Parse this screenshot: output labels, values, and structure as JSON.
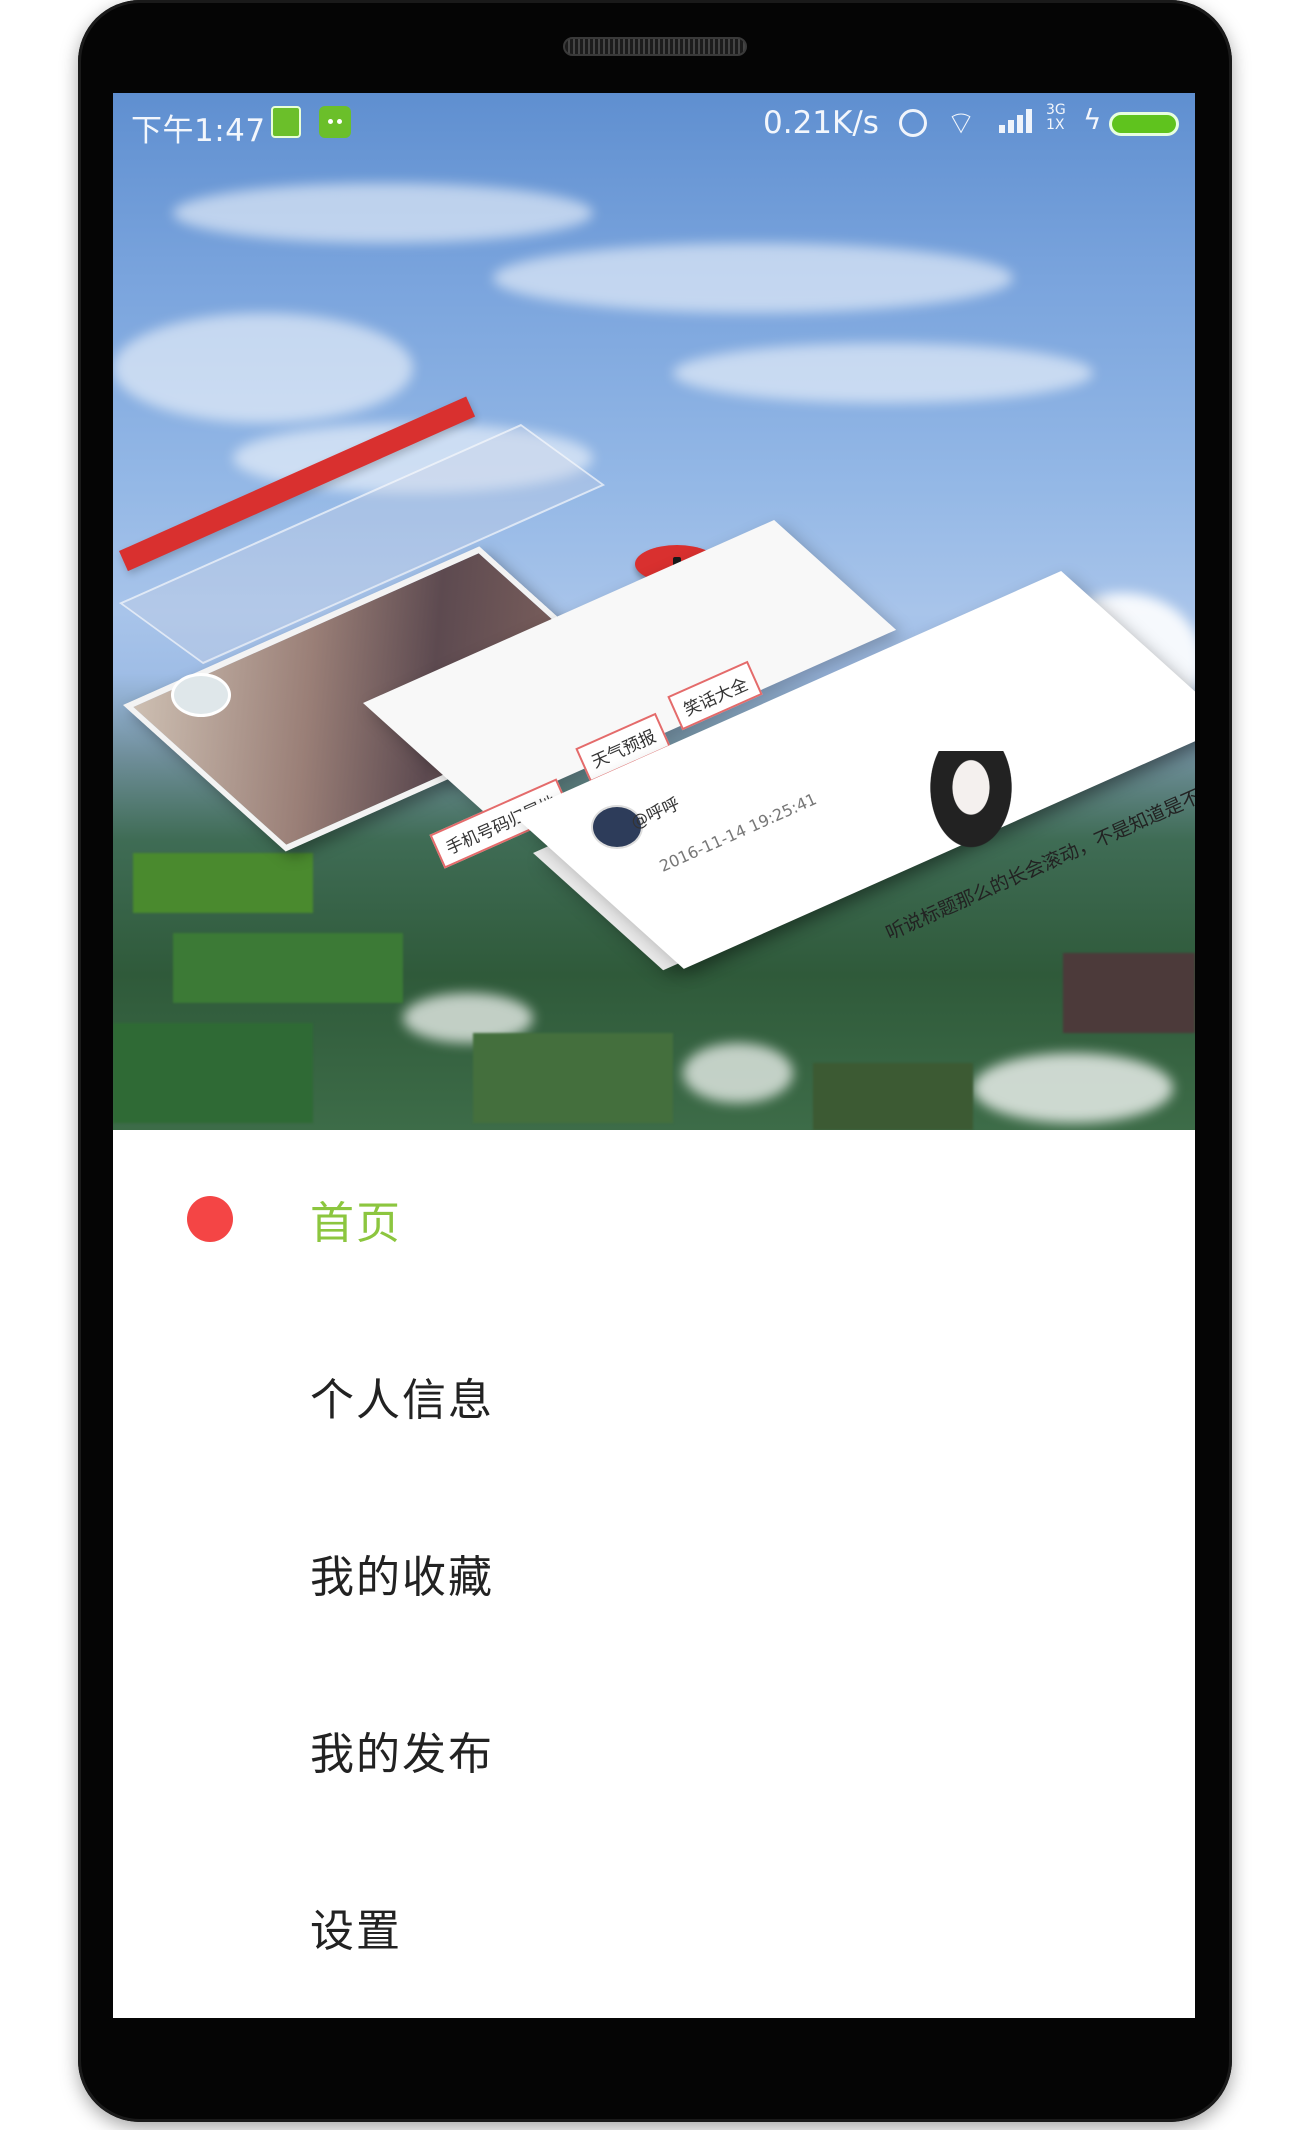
{
  "status_bar": {
    "time": "下午1:47",
    "net_speed": "0.21K/s",
    "net_type_top": "3G",
    "net_type_bottom": "1X",
    "wifi_icon": "wifi-icon",
    "bolt_icon": "charging-bolt-icon"
  },
  "header": {
    "tags": [
      "手机号码归属地",
      "天气预报",
      "笑话大全"
    ],
    "post_user": "@呼呼",
    "post_time": "2016-11-14 19:25:41",
    "post_text": "听说标题那么的长会滚动，不是知道是不是"
  },
  "nav": {
    "items": [
      {
        "label": "首页",
        "active": true
      },
      {
        "label": "个人信息",
        "active": false
      },
      {
        "label": "我的收藏",
        "active": false
      },
      {
        "label": "我的发布",
        "active": false
      },
      {
        "label": "设置",
        "active": false
      }
    ],
    "active_color": "#8cc63f",
    "indicator_color": "#f44545"
  }
}
